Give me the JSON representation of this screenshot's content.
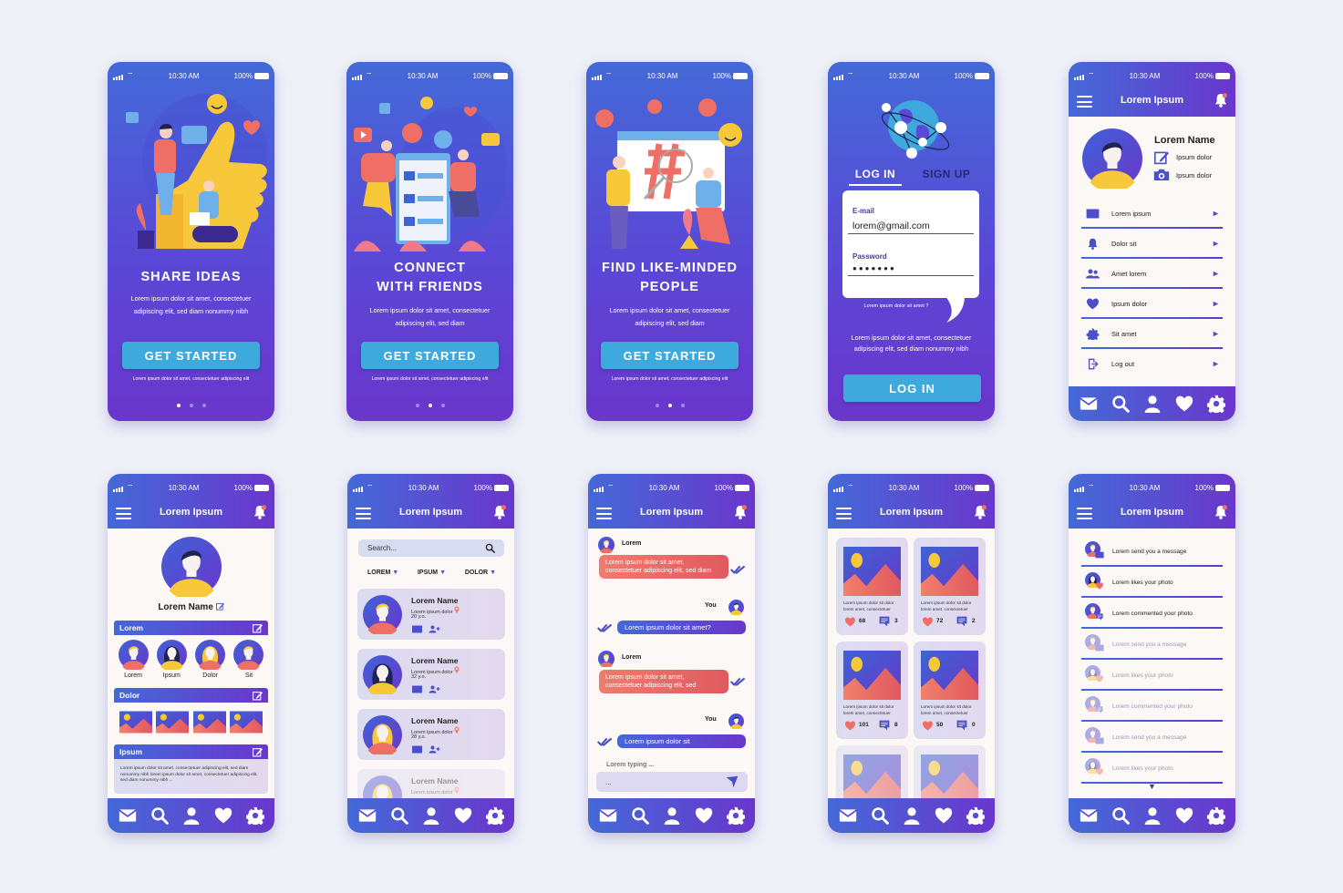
{
  "status": {
    "time": "10:30 AM",
    "battery": "100%"
  },
  "colors": {
    "primary_start": "#4469d8",
    "primary_end": "#6a36cc",
    "cta": "#3ea9dc",
    "accent_red": "#f07b6e",
    "accent_yellow": "#f7c83a",
    "bg": "#eef0f8"
  },
  "app_title": "Lorem Ipsum",
  "onboarding": [
    {
      "title_lines": [
        "SHARE IDEAS"
      ],
      "desc": "Lorem ipsum dolor sit amet, consectetuer adipiscing elit, sed diam nonummy nibh",
      "cta": "GET STARTED",
      "footnote": "Lorem ipsum dolor sit amet, consectetuer adipiscing elit",
      "active_dot": 0
    },
    {
      "title_lines": [
        "CONNECT",
        "WITH FRIENDS"
      ],
      "desc": "Lorem ipsum dolor sit amet, consectetuer adipiscing elit, sed diam",
      "cta": "GET STARTED",
      "footnote": "Lorem ipsum dolor sit amet, consectetuer adipiscing elit",
      "active_dot": 1
    },
    {
      "title_lines": [
        "FIND LIKE-MINDED",
        "PEOPLE"
      ],
      "desc": "Lorem ipsum dolor sit amet, consectetuer adipiscing elit, sed diam",
      "cta": "GET STARTED",
      "footnote": "Lorem ipsum dolor sit amet, consectetuer adipiscing elit",
      "active_dot": 1
    }
  ],
  "login": {
    "tab_login": "LOG IN",
    "tab_signup": "SIGN UP",
    "email_label": "E-mail",
    "email_value": "lorem@gmail.com",
    "password_label": "Password",
    "password_value": "●●●●●●●",
    "forgot": "Lorem ipsum dolor sit amet ?",
    "desc": "Lorem ipsum dolor sit amet, consectetuer adipiscing elit, sed diam nonummy nibh",
    "button": "LOG IN"
  },
  "profile_menu": {
    "name": "Lorem Name",
    "actions": [
      "Ipsum dolor",
      "Ipsum dolor"
    ],
    "items": [
      {
        "label": "Lorem ipsum",
        "icon": "mail-icon"
      },
      {
        "label": "Dolor sit",
        "icon": "bell-icon"
      },
      {
        "label": "Amet lorem",
        "icon": "users-icon"
      },
      {
        "label": "Ipsum dolor",
        "icon": "heart-icon"
      },
      {
        "label": "Sit amet",
        "icon": "gear-icon"
      },
      {
        "label": "Log out",
        "icon": "logout-icon"
      }
    ]
  },
  "profile": {
    "name": "Lorem Name",
    "sections": [
      "Lorem",
      "Dolor",
      "Ipsum"
    ],
    "friends": [
      "Lorem",
      "Ipsum",
      "Dolor",
      "Sit"
    ],
    "about": "Lorem ipsum dolor sit amet, consectetuer adipiscing elit, sed diam nonummy nibh lorem ipsum dolor sit amet, consectetuer adipiscing elit, sed diam nonummy nibh ..."
  },
  "search": {
    "placeholder": "Search...",
    "filters": [
      "LOREM",
      "IPSUM",
      "DOLOR"
    ],
    "results": [
      {
        "name": "Lorem Name",
        "location": "Lorem ipsum dolor",
        "age": "20 y.o."
      },
      {
        "name": "Lorem Name",
        "location": "Lorem ipsum dolor",
        "age": "32 y.o."
      },
      {
        "name": "Lorem Name",
        "location": "Lorem ipsum dolor",
        "age": "28 y.o."
      },
      {
        "name": "Lorem Name",
        "location": "Lorem ipsum dolor",
        "age": ""
      }
    ]
  },
  "chat": {
    "messages": [
      {
        "from": "Lorem",
        "text": "Lorem ipsum dolor sit amet, consectetuer adipiscing elit, sed diam",
        "mine": false
      },
      {
        "from": "You",
        "text": "Lorem ipsum dolor sit amet?",
        "mine": true
      },
      {
        "from": "Lorem",
        "text": "Lorem ipsum dolor sit amet, consectetuer adipiscing elit, sed",
        "mine": false
      },
      {
        "from": "You",
        "text": "Lorem ipsum dolor sit",
        "mine": true
      }
    ],
    "typing": "Lorem typing ...",
    "input_value": "..."
  },
  "gallery": {
    "caption": "Lorem ipsum dolor sit dolor lorem amet, consectetuer",
    "posts": [
      {
        "likes": "68",
        "comments": "3"
      },
      {
        "likes": "72",
        "comments": "2"
      },
      {
        "likes": "101",
        "comments": "8"
      },
      {
        "likes": "50",
        "comments": "0"
      }
    ]
  },
  "notifications": [
    {
      "text": "Lorem send you a message",
      "faded": false
    },
    {
      "text": "Lorem likes your photo",
      "faded": false
    },
    {
      "text": "Lorem commented your photo",
      "faded": false
    },
    {
      "text": "Lorem send you a message",
      "faded": true
    },
    {
      "text": "Lorem likes your photo",
      "faded": true
    },
    {
      "text": "Lorem commented your photo",
      "faded": true
    },
    {
      "text": "Lorem send you a message",
      "faded": true
    },
    {
      "text": "Lorem likes your photo",
      "faded": true
    }
  ],
  "navbar": [
    "mail-icon",
    "search-icon",
    "profile-icon",
    "heart-icon",
    "gear-icon"
  ]
}
